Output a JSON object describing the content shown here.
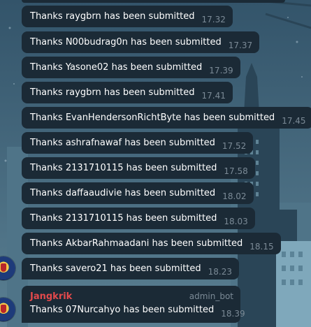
{
  "messages": [
    {
      "text": "Thanks raygbrn has been submitted",
      "time": "17.32"
    },
    {
      "text": "Thanks N00budrag0n has been submitted",
      "time": "17.37"
    },
    {
      "text": "Thanks Yasone02 has been submitted",
      "time": "17.39"
    },
    {
      "text": "Thanks raygbrn has been submitted",
      "time": "17.41"
    },
    {
      "text": "Thanks EvanHendersonRichtByte has been submitted",
      "time": "17.45"
    },
    {
      "text": "Thanks ashrafnawaf has been submitted",
      "time": "17.52"
    },
    {
      "text": "Thanks 2131710115 has been submitted",
      "time": "17.58"
    },
    {
      "text": "Thanks daffaaudivie has been submitted",
      "time": "18.02"
    },
    {
      "text": "Thanks 2131710115 has been submitted",
      "time": "18.03"
    },
    {
      "text": "Thanks AkbarRahmaadani has been submitted",
      "time": "18.15"
    },
    {
      "text": "Thanks savero21 has been submitted",
      "time": "18.23"
    }
  ],
  "last_message": {
    "sender": "Jangkrik",
    "role": "admin_bot",
    "text": "Thanks 07Nurcahyo has been submitted",
    "time": "18.39"
  },
  "colors": {
    "background": "#3f6275",
    "bubble": "#1b2a36",
    "sender_name": "#e2494b",
    "time": "#7b8a96"
  }
}
